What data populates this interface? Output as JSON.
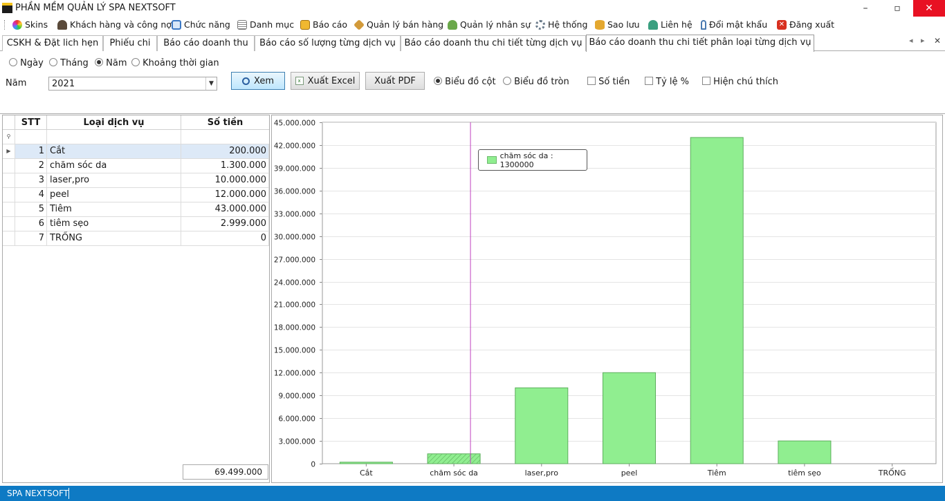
{
  "window": {
    "title": "PHẦN MỀM QUẢN LÝ SPA NEXTSOFT",
    "minimize": "–",
    "maximize": "▫",
    "close": "✕"
  },
  "menu": [
    {
      "label": "Skins",
      "icon": "palette-icon",
      "color": "#d04fd0"
    },
    {
      "label": "Khách hàng và công nợ",
      "icon": "person-icon",
      "color": "#5a4a3a"
    },
    {
      "label": "Chức năng",
      "icon": "window-icon",
      "color": "#3b78c4"
    },
    {
      "label": "Danh mục",
      "icon": "list-icon",
      "color": "#7b7b7b"
    },
    {
      "label": "Báo cáo",
      "icon": "report-icon",
      "color": "#e0a020"
    },
    {
      "label": "Quản lý bán hàng",
      "icon": "box-icon",
      "color": "#c88a2a"
    },
    {
      "label": "Quản lý nhân sự",
      "icon": "people-icon",
      "color": "#5a9a3a"
    },
    {
      "label": "Hệ thống",
      "icon": "gears-icon",
      "color": "#6a7a8a"
    },
    {
      "label": "Sao lưu",
      "icon": "database-icon",
      "color": "#d8a030"
    },
    {
      "label": "Liên hệ",
      "icon": "contact-icon",
      "color": "#3aa080"
    },
    {
      "label": "Đổi mật khẩu",
      "icon": "key-icon",
      "color": "#4a7ab0"
    },
    {
      "label": "Đăng xuất",
      "icon": "logout-icon",
      "color": "#d83020"
    }
  ],
  "tabs": [
    {
      "label": "CSKH & Đặt lich hẹn"
    },
    {
      "label": "Phiếu chi"
    },
    {
      "label": "Báo cáo doanh thu"
    },
    {
      "label": "Báo cáo số lượng từng dịch vụ"
    },
    {
      "label": "Báo cáo doanh thu chi tiết từng dịch vụ"
    },
    {
      "label": "Báo cáo doanh thu chi tiết phân loại từng dịch vụ"
    }
  ],
  "tab_nav": {
    "prev": "◂",
    "next": "▸",
    "close": "✕"
  },
  "filter": {
    "period_options": [
      "Ngày",
      "Tháng",
      "Năm",
      "Khoảng thời gian"
    ],
    "period_selected": "Năm",
    "year_label": "Năm",
    "year_value": "2021",
    "btn_view": "Xem",
    "btn_excel": "Xuất Excel",
    "btn_pdf": "Xuất PDF",
    "chart_type_options": [
      "Biểu đồ cột",
      "Biểu đồ tròn"
    ],
    "chart_type_selected": "Biểu đồ cột",
    "checkboxes": [
      "Số tiền",
      "Tỷ lệ %",
      "Hiện chú thích"
    ]
  },
  "grid": {
    "headers": [
      "STT",
      "Loại dịch vụ",
      "Số tiền"
    ],
    "filter_row_icon": "filter-pin-icon",
    "rows": [
      {
        "stt": "1",
        "name": "Cắt",
        "amount": "200.000"
      },
      {
        "stt": "2",
        "name": "chăm sóc da",
        "amount": "1.300.000"
      },
      {
        "stt": "3",
        "name": "laser,pro",
        "amount": "10.000.000"
      },
      {
        "stt": "4",
        "name": "peel",
        "amount": "12.000.000"
      },
      {
        "stt": "5",
        "name": "Tiêm",
        "amount": "43.000.000"
      },
      {
        "stt": "6",
        "name": "tiêm sẹo",
        "amount": "2.999.000"
      },
      {
        "stt": "7",
        "name": "TRỐNG",
        "amount": "0"
      }
    ],
    "selected_row": 0,
    "total": "69.499.000"
  },
  "chart_data": {
    "type": "bar",
    "categories": [
      "Cắt",
      "chăm sóc da",
      "laser,pro",
      "peel",
      "Tiêm",
      "tiêm sẹo",
      "TRỐNG"
    ],
    "values": [
      200000,
      1300000,
      10000000,
      12000000,
      43000000,
      2999000,
      0
    ],
    "ylim": [
      0,
      45000000
    ],
    "yticks": [
      0,
      3000000,
      6000000,
      9000000,
      12000000,
      15000000,
      18000000,
      21000000,
      24000000,
      27000000,
      30000000,
      33000000,
      36000000,
      39000000,
      42000000,
      45000000
    ],
    "ytick_labels": [
      "0",
      "3.000.000",
      "6.000.000",
      "9.000.000",
      "12.000.000",
      "15.000.000",
      "18.000.000",
      "21.000.000",
      "24.000.000",
      "27.000.000",
      "30.000.000",
      "33.000.000",
      "36.000.000",
      "39.000.000",
      "42.000.000",
      "45.000.000"
    ],
    "bar_color": "#90ee90",
    "bar_border": "#5cae5c",
    "grid": true,
    "hovered_category": "chăm sóc da",
    "tooltip": "chăm sóc da : 1300000",
    "crosshair_color": "#c040c0"
  },
  "status": {
    "text": "SPA NEXTSOFT",
    "color": "#0e7ac4"
  }
}
